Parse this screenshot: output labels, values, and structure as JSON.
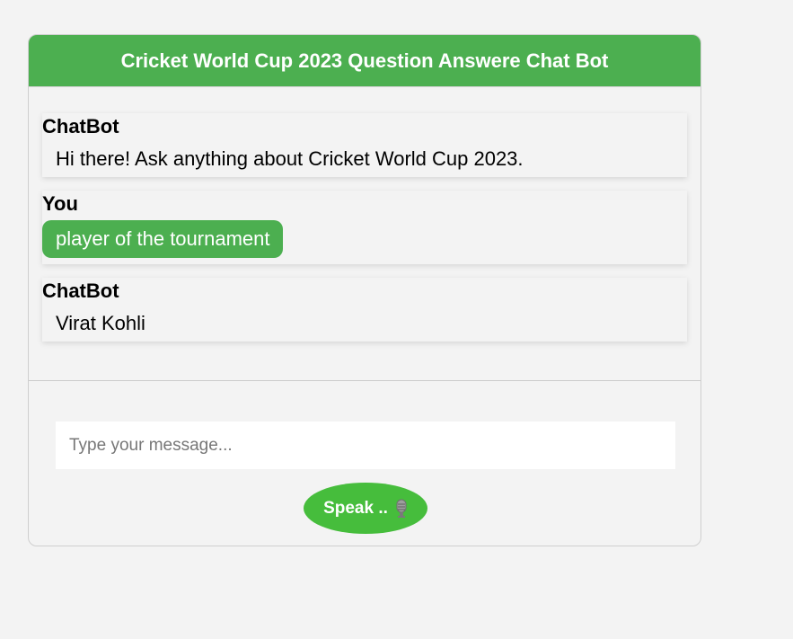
{
  "header": {
    "title": "Cricket World Cup 2023 Question Answere Chat Bot"
  },
  "messages": [
    {
      "sender": "ChatBot",
      "text": "Hi there! Ask anything about Cricket World Cup 2023.",
      "role": "bot"
    },
    {
      "sender": "You",
      "text": "player of the tournament",
      "role": "user"
    },
    {
      "sender": "ChatBot",
      "text": "Virat Kohli",
      "role": "bot"
    }
  ],
  "input": {
    "placeholder": "Type your message...",
    "value": ""
  },
  "speak_button": {
    "label": "Speak ..",
    "icon": "microphone-icon"
  },
  "colors": {
    "header": "#4caf50",
    "user_bubble": "#4caf50",
    "speak_button": "#46bd3c",
    "background": "#f3f3f3"
  }
}
